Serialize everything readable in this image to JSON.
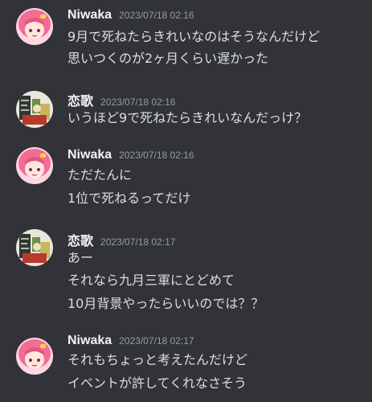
{
  "users": {
    "niwaka": "Niwaka",
    "renka": "恋歌"
  },
  "messages": [
    {
      "user": "Niwaka",
      "avatar_icon": "niwaka-avatar-icon",
      "timestamp": "2023/07/18 02:16",
      "lines": [
        "9月で死ねたらきれいなのはそうなんだけど",
        "思いつくのが2ヶ月くらい遅かった"
      ]
    },
    {
      "user": "恋歌",
      "avatar_icon": "renka-avatar-icon",
      "timestamp": "2023/07/18 02:16",
      "lines": [
        "いうほど9で死ねたらきれいなんだっけ？"
      ]
    },
    {
      "user": "Niwaka",
      "avatar_icon": "niwaka-avatar-icon",
      "timestamp": "2023/07/18 02:16",
      "lines": [
        "ただたんに",
        "1位で死ねるってだけ"
      ]
    },
    {
      "user": "恋歌",
      "avatar_icon": "renka-avatar-icon",
      "timestamp": "2023/07/18 02:17",
      "lines": [
        "あー",
        "それなら九月三軍にとどめて",
        "10月背景やったらいいのでは？？"
      ]
    },
    {
      "user": "Niwaka",
      "avatar_icon": "niwaka-avatar-icon",
      "timestamp": "2023/07/18 02:17",
      "lines": [
        "それもちょっと考えたんだけど",
        "イベントが許してくれなさそう"
      ]
    }
  ],
  "colors": {
    "background": "#313338",
    "username": "#f2f3f5",
    "timestamp": "#949ba4",
    "message_text": "#dbdee1",
    "niwaka_avatar_bg": "#ffd6e4",
    "niwaka_hair": "#f26d93",
    "renka_avatar_bg": "#e9e6dc"
  }
}
